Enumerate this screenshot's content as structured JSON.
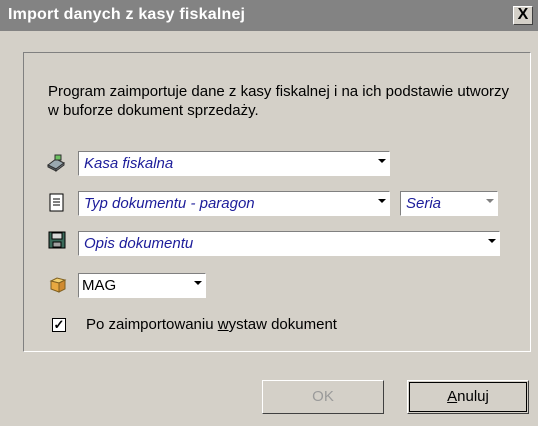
{
  "window": {
    "title": "Import danych z kasy fiskalnej",
    "close_label": "X"
  },
  "description": "Program zaimportuje dane z kasy fiskalnej i na ich podstawie utworzy w buforze dokument sprzedaży.",
  "fields": {
    "register": {
      "value": "Kasa fiskalna",
      "icon": "cash-register-icon"
    },
    "doc_type": {
      "value": "Typ dokumentu - paragon",
      "icon": "document-icon"
    },
    "series": {
      "value": "Seria",
      "disabled": true
    },
    "doc_desc": {
      "value": "Opis dokumentu",
      "icon": "floppy-disk-icon"
    },
    "warehouse": {
      "value": "MAG",
      "icon": "warehouse-box-icon"
    }
  },
  "checkbox": {
    "checked": true,
    "label_before": "Po zaimportowaniu ",
    "label_underlined": "w",
    "label_after": "ystaw dokument"
  },
  "buttons": {
    "ok": {
      "label": "OK",
      "enabled": false
    },
    "cancel_underlined": "A",
    "cancel_rest": "nuluj"
  }
}
